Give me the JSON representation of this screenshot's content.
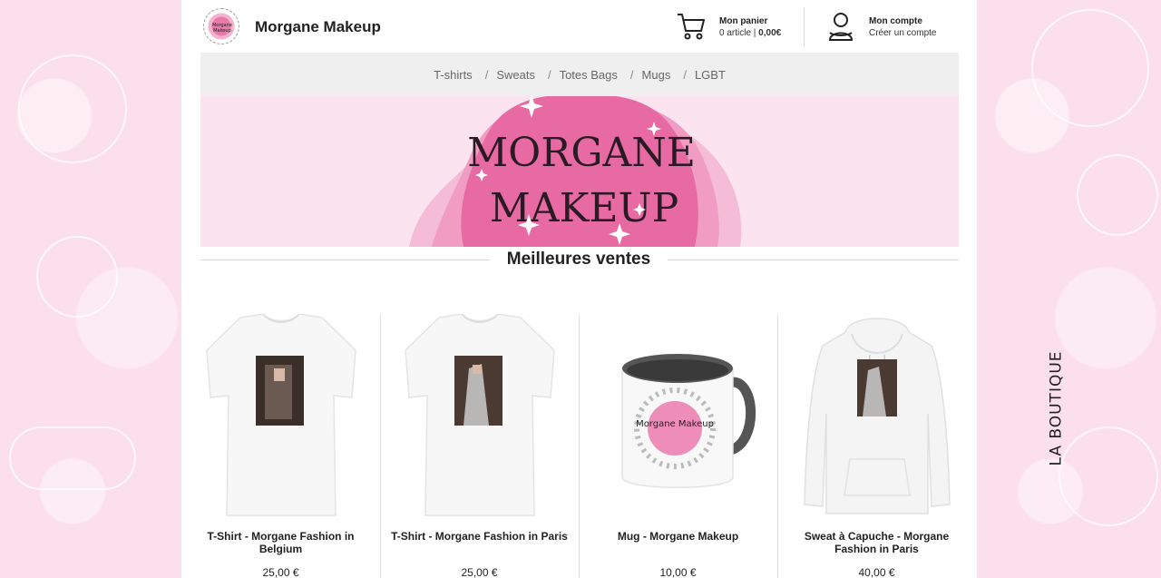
{
  "header": {
    "shop_name": "Morgane Makeup",
    "logo_text": "Morgane Makeup",
    "cart_title": "Mon panier",
    "cart_count": "0 article",
    "cart_separator": " | ",
    "cart_total": "0,00€",
    "account_title": "Mon compte",
    "account_link": "Créer un compte"
  },
  "nav": {
    "items": [
      "T-shirts",
      "Sweats",
      "Totes Bags",
      "Mugs",
      "LGBT"
    ],
    "separator": "/"
  },
  "banner": {
    "line1": "MORGANE",
    "line2": "MAKEUP"
  },
  "best_sellers": {
    "title": "Meilleures ventes"
  },
  "products": [
    {
      "name": "T-Shirt - Morgane Fashion in Belgium",
      "price": "25,00 €",
      "type": "tshirt"
    },
    {
      "name": "T-Shirt - Morgane Fashion in Paris",
      "price": "25,00 €",
      "type": "tshirt"
    },
    {
      "name": "Mug - Morgane Makeup",
      "price": "10,00 €",
      "type": "mug"
    },
    {
      "name": "Sweat à Capuche - Morgane Fashion in Paris",
      "price": "40,00 €",
      "type": "hoodie"
    }
  ],
  "side_label": "LA BOUTIQUE",
  "colors": {
    "background_pink": "#fbe0ec",
    "banner_pink": "#e86aa3",
    "nav_bg": "#efefef"
  }
}
